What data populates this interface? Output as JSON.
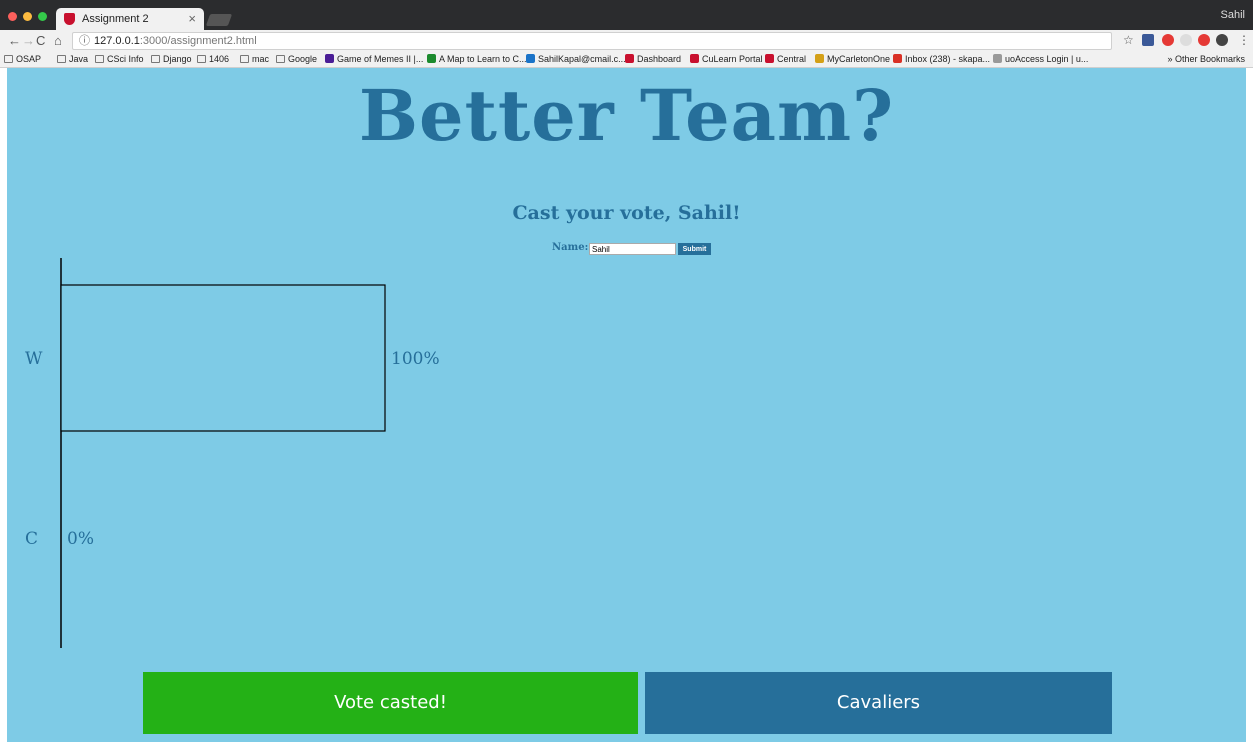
{
  "browser": {
    "tab_title": "Assignment 2",
    "tab_close": "×",
    "profile_name": "Sahil",
    "url_host": "127.0.0.1",
    "url_path": ":3000/assignment2.html",
    "bookmarks": [
      "OSAP",
      "Java",
      "CSci Info",
      "Django",
      "1406",
      "mac",
      "Google",
      "Game of Memes II |...",
      "A Map to Learn to C...",
      "SahilKapal@cmail.c...",
      "Dashboard",
      "CuLearn Portal",
      "Central",
      "MyCarletonOne",
      "Inbox (238) - skapa...",
      "uoAccess Login | u..."
    ],
    "other_bookmarks": "» Other Bookmarks"
  },
  "page": {
    "title": "Better Team?",
    "subtitle": "Cast your vote, Sahil!",
    "form": {
      "label": "Name:",
      "value": "Sahil",
      "submit_label": "Submit"
    },
    "buttons": {
      "vote_label": "Vote casted!",
      "cavaliers_label": "Cavaliers"
    }
  },
  "chart_data": {
    "type": "bar",
    "orientation": "horizontal",
    "categories": [
      "W",
      "C"
    ],
    "values": [
      100,
      0
    ],
    "value_labels": [
      "100%",
      "0%"
    ],
    "xlim": [
      0,
      100
    ],
    "colors": {
      "bar_fill": "#7ecbe6",
      "bar_stroke": "#000000",
      "text": "#266f9a"
    }
  }
}
